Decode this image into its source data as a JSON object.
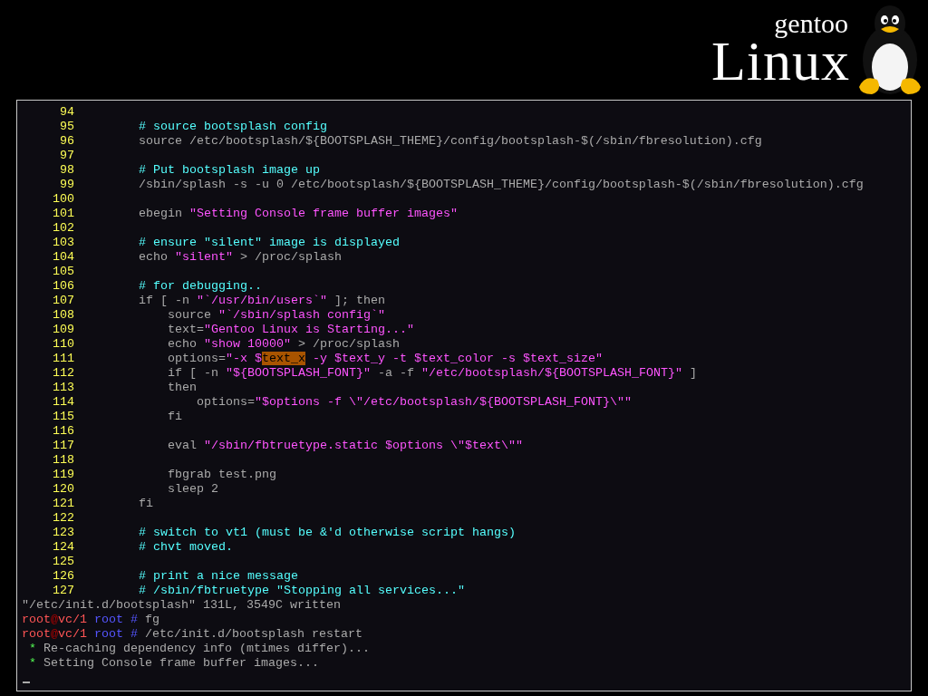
{
  "logo": {
    "small": "gentoo",
    "large": "Linux"
  },
  "editor_lines": [
    {
      "number": "94"
    },
    {
      "number": "95",
      "segments": [
        {
          "kind": "comment",
          "text": "# source bootsplash config"
        }
      ]
    },
    {
      "number": "96",
      "segments": [
        {
          "kind": "plain",
          "text": "source /etc/bootsplash/${BOOTSPLASH_THEME}/config/bootsplash-$(/sbin/fbresolution).cfg"
        }
      ]
    },
    {
      "number": "97"
    },
    {
      "number": "98",
      "segments": [
        {
          "kind": "comment",
          "text": "# Put bootsplash image up"
        }
      ]
    },
    {
      "number": "99",
      "segments": [
        {
          "kind": "plain",
          "text": "/sbin/splash -s -u 0 /etc/bootsplash/${BOOTSPLASH_THEME}/config/bootsplash-$(/sbin/fbresolution).cfg"
        }
      ]
    },
    {
      "number": "100"
    },
    {
      "number": "101",
      "segments": [
        {
          "kind": "plain",
          "text": "ebegin "
        },
        {
          "kind": "string",
          "text": "\"Setting Console frame buffer images\""
        }
      ]
    },
    {
      "number": "102"
    },
    {
      "number": "103",
      "segments": [
        {
          "kind": "comment",
          "text": "# ensure \"silent\" image is displayed"
        }
      ]
    },
    {
      "number": "104",
      "segments": [
        {
          "kind": "plain",
          "text": "echo "
        },
        {
          "kind": "string",
          "text": "\"silent\""
        },
        {
          "kind": "plain",
          "text": " > /proc/splash"
        }
      ]
    },
    {
      "number": "105"
    },
    {
      "number": "106",
      "segments": [
        {
          "kind": "comment",
          "text": "# for debugging.."
        }
      ]
    },
    {
      "number": "107",
      "segments": [
        {
          "kind": "plain",
          "text": "if [ -n "
        },
        {
          "kind": "string",
          "text": "\"`/usr/bin/users`\""
        },
        {
          "kind": "plain",
          "text": " ]; then"
        }
      ]
    },
    {
      "number": "108",
      "segments": [
        {
          "kind": "plain",
          "text": "    source "
        },
        {
          "kind": "string",
          "text": "\"`/sbin/splash config`\""
        }
      ]
    },
    {
      "number": "109",
      "segments": [
        {
          "kind": "plain",
          "text": "    text="
        },
        {
          "kind": "string",
          "text": "\"Gentoo Linux is Starting...\""
        }
      ]
    },
    {
      "number": "110",
      "segments": [
        {
          "kind": "plain",
          "text": "    echo "
        },
        {
          "kind": "string",
          "text": "\"show 10000\""
        },
        {
          "kind": "plain",
          "text": " > /proc/splash"
        }
      ]
    },
    {
      "number": "111",
      "segments": [
        {
          "kind": "plain",
          "text": "    options="
        },
        {
          "kind": "string",
          "text": "\"-x $"
        },
        {
          "kind": "highlight",
          "text": "text_x"
        },
        {
          "kind": "string",
          "text": " -y $text_y -t $text_color -s $text_size\""
        }
      ]
    },
    {
      "number": "112",
      "segments": [
        {
          "kind": "plain",
          "text": "    if [ -n "
        },
        {
          "kind": "string",
          "text": "\"${BOOTSPLASH_FONT}\""
        },
        {
          "kind": "plain",
          "text": " -a -f "
        },
        {
          "kind": "string",
          "text": "\"/etc/bootsplash/${BOOTSPLASH_FONT}\""
        },
        {
          "kind": "plain",
          "text": " ]"
        }
      ]
    },
    {
      "number": "113",
      "segments": [
        {
          "kind": "plain",
          "text": "    then"
        }
      ]
    },
    {
      "number": "114",
      "segments": [
        {
          "kind": "plain",
          "text": "        options="
        },
        {
          "kind": "string",
          "text": "\"$options -f \\\"/etc/bootsplash/${BOOTSPLASH_FONT}\\\"\""
        }
      ]
    },
    {
      "number": "115",
      "segments": [
        {
          "kind": "plain",
          "text": "    fi"
        }
      ]
    },
    {
      "number": "116"
    },
    {
      "number": "117",
      "segments": [
        {
          "kind": "plain",
          "text": "    eval "
        },
        {
          "kind": "string",
          "text": "\"/sbin/fbtruetype.static $options \\\"$text\\\"\""
        }
      ]
    },
    {
      "number": "118"
    },
    {
      "number": "119",
      "segments": [
        {
          "kind": "plain",
          "text": "    fbgrab test.png"
        }
      ]
    },
    {
      "number": "120",
      "segments": [
        {
          "kind": "plain",
          "text": "    sleep 2"
        }
      ]
    },
    {
      "number": "121",
      "segments": [
        {
          "kind": "plain",
          "text": "fi"
        }
      ]
    },
    {
      "number": "122"
    },
    {
      "number": "123",
      "segments": [
        {
          "kind": "comment",
          "text": "# switch to vt1 (must be &'d otherwise script hangs)"
        }
      ]
    },
    {
      "number": "124",
      "segments": [
        {
          "kind": "comment",
          "text": "# chvt moved."
        }
      ]
    },
    {
      "number": "125"
    },
    {
      "number": "126",
      "segments": [
        {
          "kind": "comment",
          "text": "# print a nice message"
        }
      ]
    },
    {
      "number": "127",
      "segments": [
        {
          "kind": "comment",
          "text": "# /sbin/fbtruetype \"Stopping all services...\""
        }
      ]
    }
  ],
  "console_lines": [
    {
      "kind": "output",
      "text": "\"/etc/init.d/bootsplash\" 131L, 3549C written"
    },
    {
      "kind": "prompt",
      "user": "root",
      "at": "@",
      "host": "vc/1",
      "dir": "root",
      "sign": "#",
      "command": "fg"
    },
    {
      "kind": "prompt",
      "user": "root",
      "at": "@",
      "host": "vc/1",
      "dir": "root",
      "sign": "#",
      "command": "/etc/init.d/bootsplash restart"
    },
    {
      "kind": "info",
      "bullet": "*",
      "text": "Re-caching dependency info (mtimes differ)..."
    },
    {
      "kind": "info",
      "bullet": "*",
      "text": "Setting Console frame buffer images..."
    }
  ],
  "cursor": {
    "visible": true
  }
}
